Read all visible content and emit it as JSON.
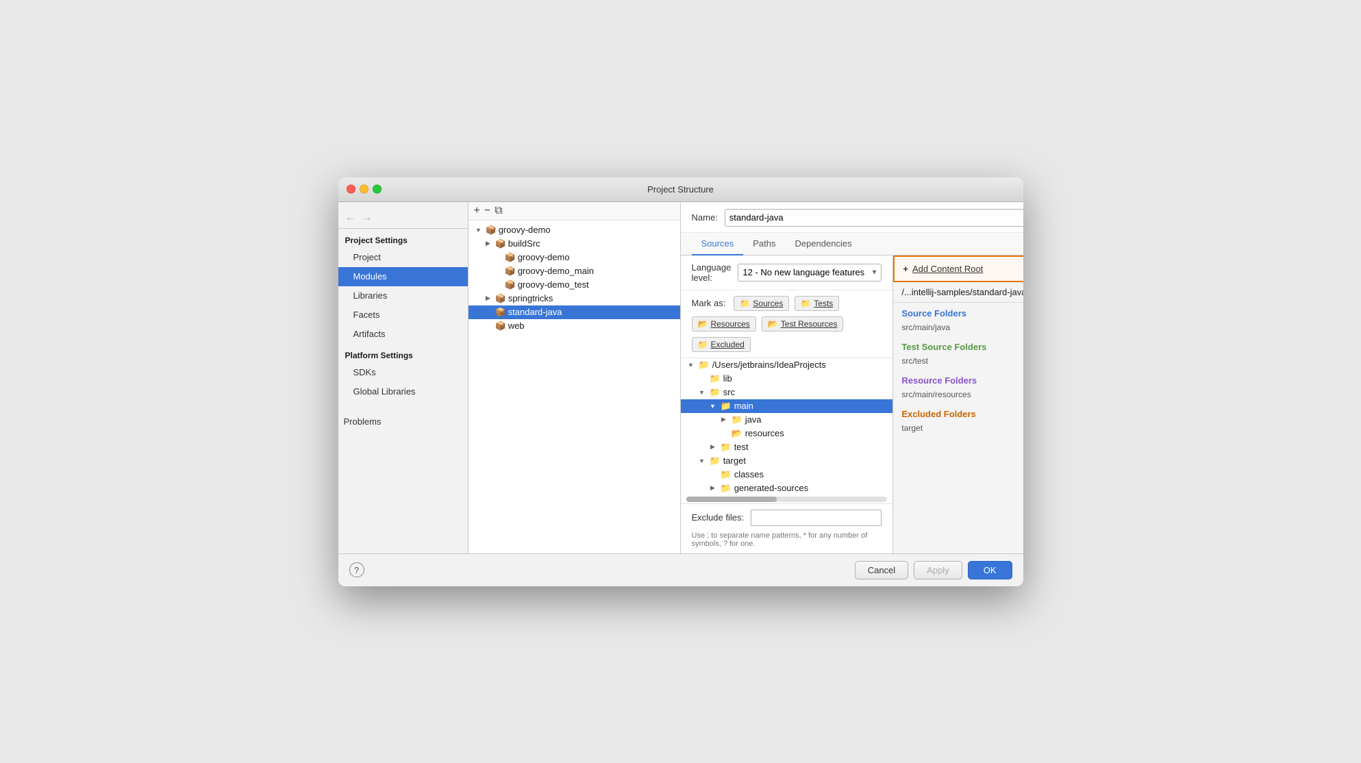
{
  "dialog": {
    "title": "Project Structure"
  },
  "sidebar": {
    "project_settings_header": "Project Settings",
    "platform_settings_header": "Platform Settings",
    "items": [
      {
        "label": "Project",
        "active": false,
        "indent": true
      },
      {
        "label": "Modules",
        "active": true,
        "indent": true
      },
      {
        "label": "Libraries",
        "active": false,
        "indent": true
      },
      {
        "label": "Facets",
        "active": false,
        "indent": true
      },
      {
        "label": "Artifacts",
        "active": false,
        "indent": true
      },
      {
        "label": "SDKs",
        "active": false,
        "indent": true
      },
      {
        "label": "Global Libraries",
        "active": false,
        "indent": true
      },
      {
        "label": "Problems",
        "active": false,
        "indent": false
      }
    ]
  },
  "tree": {
    "toolbar": {
      "add": "+",
      "remove": "−",
      "copy": "⧉"
    },
    "items": [
      {
        "label": "groovy-demo",
        "indent": 0,
        "expanded": true,
        "type": "module"
      },
      {
        "label": "buildSrc",
        "indent": 1,
        "expanded": false,
        "type": "module"
      },
      {
        "label": "groovy-demo",
        "indent": 2,
        "expanded": false,
        "type": "module"
      },
      {
        "label": "groovy-demo_main",
        "indent": 2,
        "expanded": false,
        "type": "module"
      },
      {
        "label": "groovy-demo_test",
        "indent": 2,
        "expanded": false,
        "type": "module"
      },
      {
        "label": "springtricks",
        "indent": 1,
        "expanded": false,
        "type": "module"
      },
      {
        "label": "standard-java",
        "indent": 1,
        "expanded": false,
        "type": "module",
        "selected": true
      },
      {
        "label": "web",
        "indent": 1,
        "expanded": false,
        "type": "module"
      }
    ]
  },
  "main": {
    "name_label": "Name:",
    "name_value": "standard-java",
    "tabs": [
      {
        "label": "Sources",
        "active": true
      },
      {
        "label": "Paths",
        "active": false
      },
      {
        "label": "Dependencies",
        "active": false
      }
    ],
    "lang_level_label": "Language level:",
    "lang_level_value": "12 - No new language features",
    "mark_as_label": "Mark as:",
    "mark_as_buttons": [
      {
        "label": "Sources",
        "icon": "📁",
        "color": "blue"
      },
      {
        "label": "Tests",
        "icon": "📁",
        "color": "green"
      },
      {
        "label": "Resources",
        "icon": "📂",
        "color": "gray"
      },
      {
        "label": "Test Resources",
        "icon": "📂",
        "color": "gray"
      },
      {
        "label": "Excluded",
        "icon": "📁",
        "color": "orange"
      }
    ],
    "file_tree": [
      {
        "label": "/Users/jetbrains/IdeaProjects",
        "indent": 0,
        "expanded": true
      },
      {
        "label": "lib",
        "indent": 1,
        "expanded": false
      },
      {
        "label": "src",
        "indent": 1,
        "expanded": true
      },
      {
        "label": "main",
        "indent": 2,
        "expanded": true,
        "selected": true
      },
      {
        "label": "java",
        "indent": 3,
        "expanded": false
      },
      {
        "label": "resources",
        "indent": 3,
        "expanded": false
      },
      {
        "label": "test",
        "indent": 2,
        "expanded": false
      },
      {
        "label": "target",
        "indent": 1,
        "expanded": true
      },
      {
        "label": "classes",
        "indent": 2,
        "expanded": false
      },
      {
        "label": "generated-sources",
        "indent": 2,
        "expanded": false
      }
    ],
    "exclude_label": "Exclude files:",
    "exclude_value": "",
    "exclude_hint": "Use ; to separate name patterns, * for any number of symbols, ? for one."
  },
  "right_panel": {
    "add_content_root_label": "+ Add Content Root",
    "content_root_path": "/...intellij-samples/standard-java",
    "sections": [
      {
        "title": "Source Folders",
        "color": "blue",
        "entries": [
          {
            "path": "src/main/java"
          }
        ]
      },
      {
        "title": "Test Source Folders",
        "color": "green",
        "entries": [
          {
            "path": "src/test"
          }
        ]
      },
      {
        "title": "Resource Folders",
        "color": "purple",
        "entries": [
          {
            "path": "src/main/resources"
          }
        ]
      },
      {
        "title": "Excluded Folders",
        "color": "orange-red",
        "entries": [
          {
            "path": "target"
          }
        ]
      }
    ]
  },
  "footer": {
    "help_label": "?",
    "cancel_label": "Cancel",
    "apply_label": "Apply",
    "ok_label": "OK"
  }
}
